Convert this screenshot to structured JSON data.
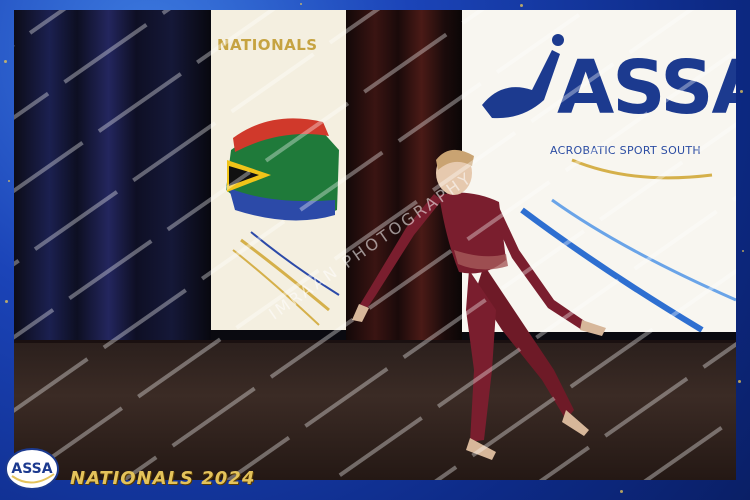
{
  "banners": {
    "left_title": "NATIONALS",
    "right_logo": "ASSA",
    "right_subtitle": "ACROBATIC SPORT SOUTH"
  },
  "watermark": {
    "text": "IMRAAN PHOTOGRAPHY"
  },
  "footer": {
    "logo_text": "ASSA",
    "event_title": "NATIONALS 2024"
  },
  "colors": {
    "frame_blue": "#1b44b8",
    "gold_accent": "#e4c35b",
    "costume_maroon": "#7a1e2e",
    "logo_navy": "#1c3a8f"
  },
  "icons": {
    "logo": "assa-logo",
    "flag": "south-africa-flag-graphic",
    "gymnast": "gymnast-silhouette"
  }
}
